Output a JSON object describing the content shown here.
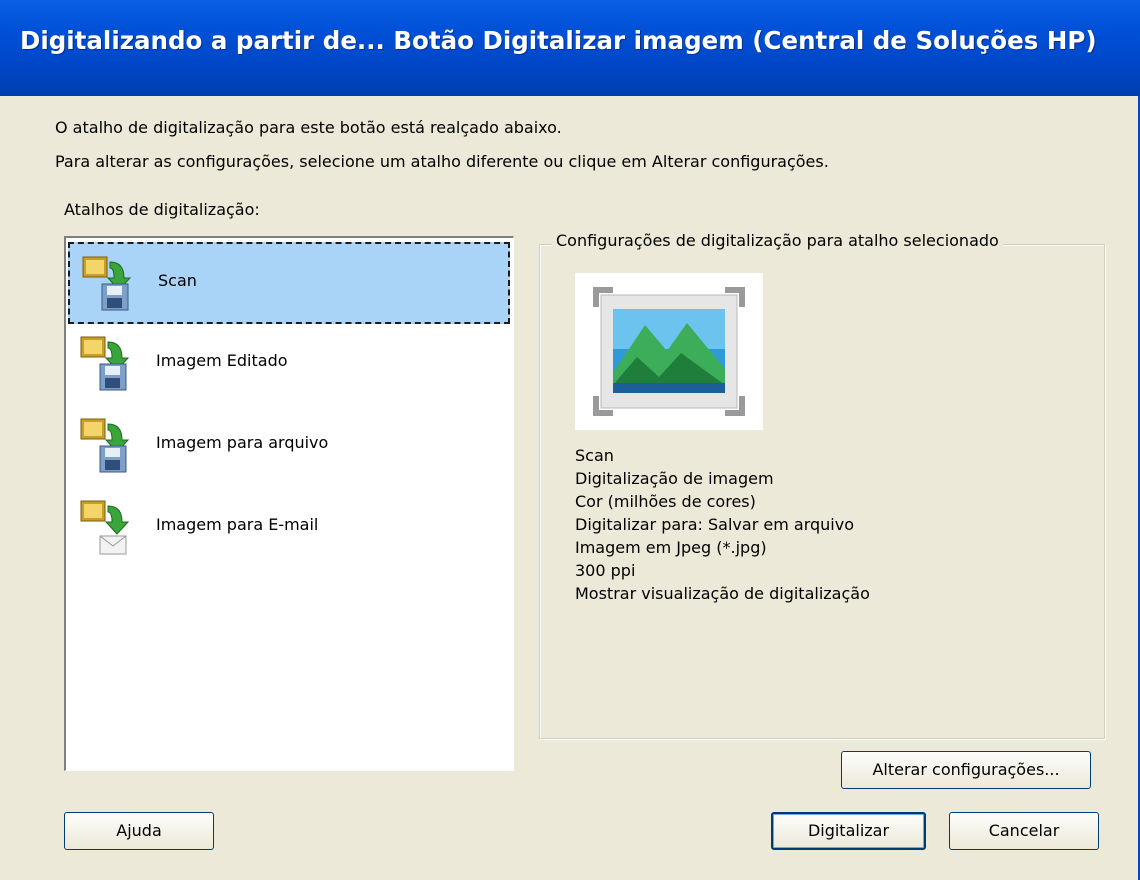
{
  "window": {
    "title": "Digitalizando a partir de... Botão Digitalizar imagem (Central de Soluções HP)"
  },
  "instructions": {
    "line1": "O atalho de digitalização para este botão está realçado abaixo.",
    "line2": "Para alterar as configurações, selecione um atalho diferente ou clique em Alterar configurações."
  },
  "shortcuts": {
    "label": "Atalhos de digitalização:",
    "items": [
      {
        "label": "Scan",
        "icon": "scan-to-file-icon",
        "selected": true
      },
      {
        "label": "Imagem Editado",
        "icon": "scan-to-file-icon",
        "selected": false
      },
      {
        "label": "Imagem para arquivo",
        "icon": "scan-to-file-icon",
        "selected": false
      },
      {
        "label": "Imagem para E-mail",
        "icon": "scan-to-email-icon",
        "selected": false
      }
    ]
  },
  "settings": {
    "legend": "Configurações de digitalização para atalho selecionado",
    "preview_icon": "landscape-image-icon",
    "lines": [
      "Scan",
      "Digitalização de imagem",
      "Cor (milhões de cores)",
      "Digitalizar para: Salvar em arquivo",
      "Imagem em Jpeg (*.jpg)",
      "300 ppi",
      "Mostrar visualização de digitalização"
    ]
  },
  "buttons": {
    "change_settings": "Alterar configurações...",
    "help": "Ajuda",
    "scan": "Digitalizar",
    "cancel": "Cancelar"
  },
  "colors": {
    "titlebar": "#0051d8",
    "selection": "#a9d4f7",
    "dialog_bg": "#ece9d8"
  }
}
